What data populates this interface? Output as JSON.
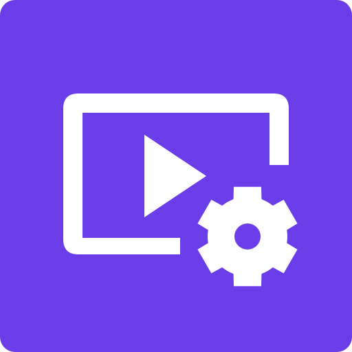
{
  "icon": {
    "background_color": "#6B3DE8",
    "foreground_color": "#FFFFFF",
    "glyphs": [
      "video-screen-icon",
      "play-icon",
      "gear-icon"
    ]
  }
}
